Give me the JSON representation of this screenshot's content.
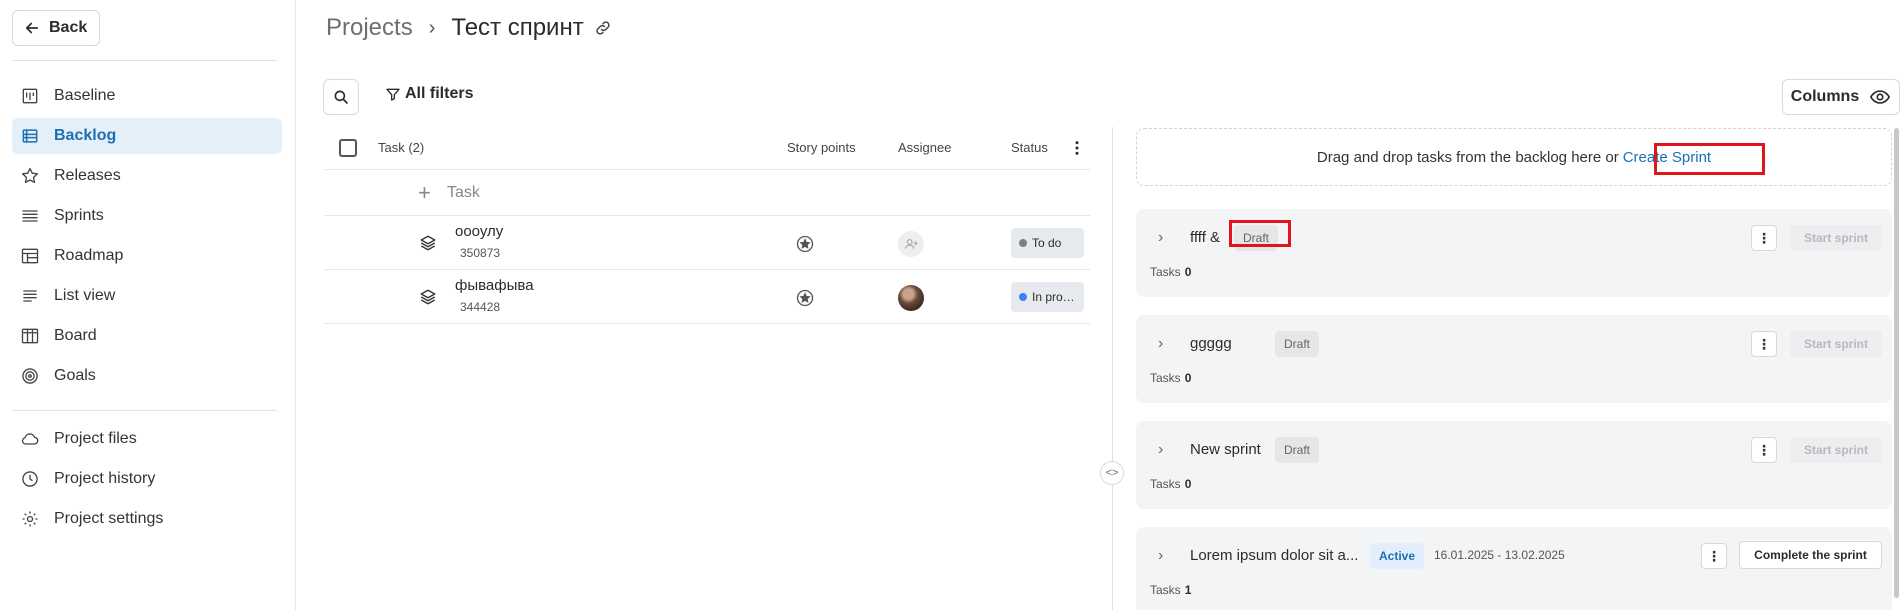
{
  "sidebar": {
    "back_label": "Back",
    "items": [
      {
        "label": "Baseline",
        "icon": "baseline-icon"
      },
      {
        "label": "Backlog",
        "icon": "backlog-icon",
        "active": true
      },
      {
        "label": "Releases",
        "icon": "star-icon"
      },
      {
        "label": "Sprints",
        "icon": "sprints-icon"
      },
      {
        "label": "Roadmap",
        "icon": "roadmap-icon"
      },
      {
        "label": "List view",
        "icon": "list-icon"
      },
      {
        "label": "Board",
        "icon": "board-icon"
      },
      {
        "label": "Goals",
        "icon": "target-icon"
      }
    ],
    "bottom_items": [
      {
        "label": "Project files",
        "icon": "cloud-icon"
      },
      {
        "label": "Project history",
        "icon": "clock-icon"
      },
      {
        "label": "Project settings",
        "icon": "gear-icon"
      }
    ]
  },
  "header": {
    "breadcrumb_root": "Projects",
    "breadcrumb_sep": "›",
    "project_name": "Тест спринт"
  },
  "toolbar": {
    "filters_label": "All filters",
    "columns_label": "Columns"
  },
  "table": {
    "col_task": "Task (2)",
    "col_story_points": "Story points",
    "col_assignee": "Assignee",
    "col_status": "Status",
    "add_task_label": "Task",
    "rows": [
      {
        "name": "оооулу",
        "id": "350873",
        "status": "To do",
        "status_color": "#7d7f83"
      },
      {
        "name": "фывафыва",
        "id": "344428",
        "status": "In pro…",
        "status_color": "#3b82f6"
      }
    ]
  },
  "backlog_panel": {
    "dropzone_text": "Drag and drop tasks from the backlog here or",
    "create_sprint_label": "Create Sprint",
    "tasks_label": "Tasks",
    "start_label": "Start sprint",
    "complete_label": "Complete the sprint",
    "sprints": [
      {
        "name": "ffff &",
        "status": "Draft",
        "tasks": "0"
      },
      {
        "name": "ggggg",
        "status": "Draft",
        "tasks": "0"
      },
      {
        "name": "New sprint",
        "status": "Draft",
        "tasks": "0"
      },
      {
        "name": "Lorem ipsum dolor sit a...",
        "status": "Active",
        "dates": "16.01.2025 - 13.02.2025",
        "tasks": "1"
      }
    ]
  },
  "colors": {
    "accent": "#1e6fb1",
    "highlight": "#e0141b",
    "active_nav_bg": "#e3f0fa"
  }
}
